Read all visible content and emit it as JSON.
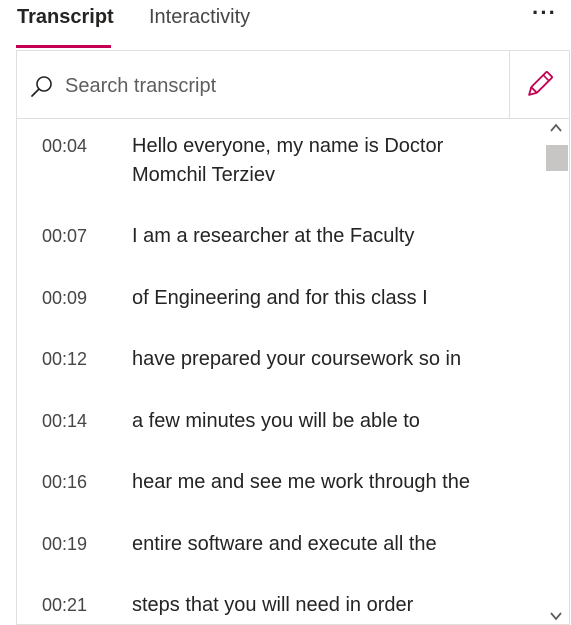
{
  "tabs": [
    {
      "label": "Transcript",
      "active": true
    },
    {
      "label": "Interactivity",
      "active": false
    }
  ],
  "more_icon": "more-horizontal-icon",
  "more_label": "···",
  "search": {
    "placeholder": "Search transcript",
    "value": "",
    "icon": "search-icon"
  },
  "edit_icon": "pencil-icon",
  "accent_color": "#c30052",
  "transcript": [
    {
      "time": "00:04",
      "text": "Hello everyone, my name is Doctor Momchil Terziev"
    },
    {
      "time": "00:07",
      "text": "I am a researcher at the Faculty"
    },
    {
      "time": "00:09",
      "text": "of Engineering and for this class I"
    },
    {
      "time": "00:12",
      "text": "have prepared your coursework so in"
    },
    {
      "time": "00:14",
      "text": "a few minutes you will be able to"
    },
    {
      "time": "00:16",
      "text": "hear me and see me work through the"
    },
    {
      "time": "00:19",
      "text": "entire software and execute all the"
    },
    {
      "time": "00:21",
      "text": "steps that you will need in order"
    }
  ]
}
